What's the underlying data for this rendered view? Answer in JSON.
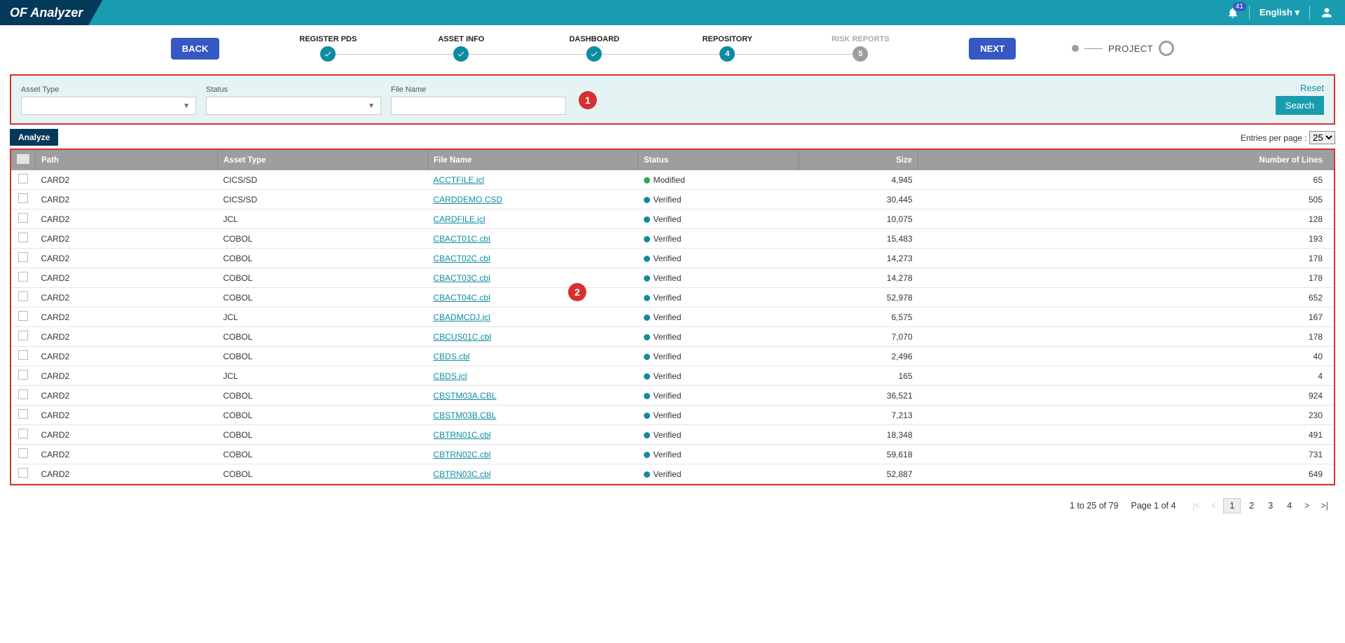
{
  "header": {
    "app_name": "OF Analyzer",
    "notif_count": "41",
    "language": "English"
  },
  "stepper": {
    "back": "BACK",
    "next": "NEXT",
    "steps": [
      {
        "label": "REGISTER PDS",
        "state": "done"
      },
      {
        "label": "ASSET INFO",
        "state": "done"
      },
      {
        "label": "DASHBOARD",
        "state": "done"
      },
      {
        "label": "REPOSITORY",
        "state": "current",
        "num": "4"
      },
      {
        "label": "RISK REPORTS",
        "state": "pending",
        "num": "5"
      }
    ],
    "project_label": "PROJECT"
  },
  "filter": {
    "asset_type_label": "Asset Type",
    "status_label": "Status",
    "file_name_label": "File Name",
    "file_name_value": "",
    "reset": "Reset",
    "search": "Search"
  },
  "callouts": {
    "c1": "1",
    "c2": "2"
  },
  "actions": {
    "analyze": "Analyze",
    "entries_label": "Entries per page :",
    "entries_value": "25"
  },
  "table": {
    "headers": {
      "path": "Path",
      "asset_type": "Asset Type",
      "file_name": "File Name",
      "status": "Status",
      "size": "Size",
      "lines": "Number of Lines"
    },
    "rows": [
      {
        "path": "CARD2",
        "type": "CICS/SD",
        "file": "ACCTFILE.jcl",
        "status": "Modified",
        "dot": "green",
        "size": "4,945",
        "lines": "65"
      },
      {
        "path": "CARD2",
        "type": "CICS/SD",
        "file": "CARDDEMO.CSD",
        "status": "Verified",
        "dot": "teal",
        "size": "30,445",
        "lines": "505"
      },
      {
        "path": "CARD2",
        "type": "JCL",
        "file": "CARDFILE.jcl",
        "status": "Verified",
        "dot": "teal",
        "size": "10,075",
        "lines": "128"
      },
      {
        "path": "CARD2",
        "type": "COBOL",
        "file": "CBACT01C.cbl",
        "status": "Verified",
        "dot": "teal",
        "size": "15,483",
        "lines": "193"
      },
      {
        "path": "CARD2",
        "type": "COBOL",
        "file": "CBACT02C.cbl",
        "status": "Verified",
        "dot": "teal",
        "size": "14,273",
        "lines": "178"
      },
      {
        "path": "CARD2",
        "type": "COBOL",
        "file": "CBACT03C.cbl",
        "status": "Verified",
        "dot": "teal",
        "size": "14,278",
        "lines": "178"
      },
      {
        "path": "CARD2",
        "type": "COBOL",
        "file": "CBACT04C.cbl",
        "status": "Verified",
        "dot": "teal",
        "size": "52,978",
        "lines": "652"
      },
      {
        "path": "CARD2",
        "type": "JCL",
        "file": "CBADMCDJ.jcl",
        "status": "Verified",
        "dot": "teal",
        "size": "6,575",
        "lines": "167"
      },
      {
        "path": "CARD2",
        "type": "COBOL",
        "file": "CBCUS01C.cbl",
        "status": "Verified",
        "dot": "teal",
        "size": "7,070",
        "lines": "178"
      },
      {
        "path": "CARD2",
        "type": "COBOL",
        "file": "CBDS.cbl",
        "status": "Verified",
        "dot": "teal",
        "size": "2,496",
        "lines": "40"
      },
      {
        "path": "CARD2",
        "type": "JCL",
        "file": "CBDS.jcl",
        "status": "Verified",
        "dot": "teal",
        "size": "165",
        "lines": "4"
      },
      {
        "path": "CARD2",
        "type": "COBOL",
        "file": "CBSTM03A.CBL",
        "status": "Verified",
        "dot": "teal",
        "size": "36,521",
        "lines": "924"
      },
      {
        "path": "CARD2",
        "type": "COBOL",
        "file": "CBSTM03B.CBL",
        "status": "Verified",
        "dot": "teal",
        "size": "7,213",
        "lines": "230"
      },
      {
        "path": "CARD2",
        "type": "COBOL",
        "file": "CBTRN01C.cbl",
        "status": "Verified",
        "dot": "teal",
        "size": "18,348",
        "lines": "491"
      },
      {
        "path": "CARD2",
        "type": "COBOL",
        "file": "CBTRN02C.cbl",
        "status": "Verified",
        "dot": "teal",
        "size": "59,618",
        "lines": "731"
      },
      {
        "path": "CARD2",
        "type": "COBOL",
        "file": "CBTRN03C.cbl",
        "status": "Verified",
        "dot": "teal",
        "size": "52,887",
        "lines": "649"
      }
    ]
  },
  "footer": {
    "range": "1 to 25 of 79",
    "page_of": "Page 1 of 4",
    "pages": [
      "1",
      "2",
      "3",
      "4"
    ]
  }
}
